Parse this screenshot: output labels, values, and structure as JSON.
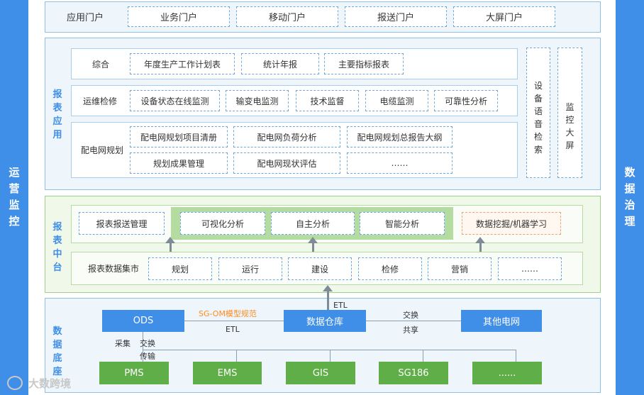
{
  "sidebars": {
    "left": "运营监控",
    "right": "数据治理"
  },
  "portal": {
    "label": "应用门户",
    "items": [
      "业务门户",
      "移动门户",
      "报送门户",
      "大屏门户"
    ]
  },
  "report_app": {
    "title": "报表应用",
    "rows": [
      {
        "label": "综合",
        "items": [
          "年度生产工作计划表",
          "统计年报",
          "主要指标报表"
        ]
      },
      {
        "label": "运维检修",
        "items": [
          "设备状态在线监测",
          "输变电监测",
          "技术监督",
          "电缆监测",
          "可靠性分析"
        ]
      },
      {
        "label": "配电网规划",
        "items": [
          "配电网规划项目清册",
          "配电网负荷分析",
          "配电网规划总报告大纲",
          "规划成果管理",
          "配电网现状评估",
          "……"
        ]
      }
    ],
    "side_boxes": [
      "设备语音检索",
      "监控大屏"
    ]
  },
  "report_mid": {
    "title": "报表中台",
    "top_left": "报表报送管理",
    "analysis": [
      "可视化分析",
      "自主分析",
      "智能分析"
    ],
    "top_right": "数据挖掘/机器学习",
    "mart_label": "报表数据集市",
    "marts": [
      "规划",
      "运行",
      "建设",
      "检修",
      "营销",
      "……"
    ]
  },
  "data_base": {
    "title": "数据底座",
    "ods": "ODS",
    "warehouse": "数据仓库",
    "other": "其他电网",
    "spec": "SG-OM模型规范",
    "etl1": "ETL",
    "etl2": "ETL",
    "exchange": "交换",
    "share": "共享",
    "collect": "采集",
    "exchange2": "交换",
    "transfer": "传输",
    "sources": [
      "PMS",
      "EMS",
      "GIS",
      "SG186",
      "......"
    ]
  },
  "watermark": "大数跨境"
}
